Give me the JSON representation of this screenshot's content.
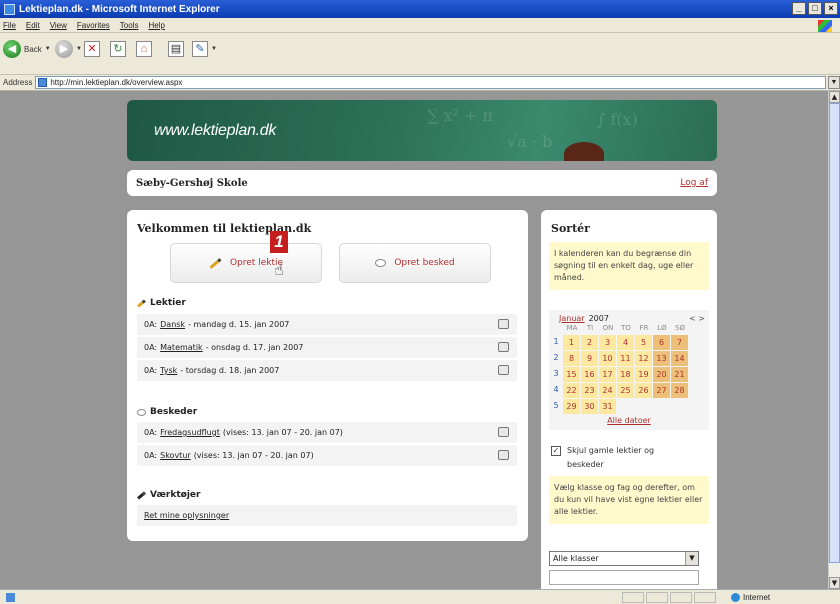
{
  "window": {
    "title": "Lektieplan.dk - Microsoft Internet Explorer",
    "btns": [
      "_",
      "□",
      "×"
    ]
  },
  "menu": [
    "File",
    "Edit",
    "View",
    "Favorites",
    "Tools",
    "Help"
  ],
  "toolbar": {
    "back": "Back"
  },
  "address": {
    "label": "Address",
    "url": "http://min.lektieplan.dk/overview.aspx"
  },
  "banner": {
    "url": "www.lektieplan.dk"
  },
  "school": {
    "name": "Sæby-Gershøj Skole",
    "logout": "Log af"
  },
  "main": {
    "title": "Velkommen til lektieplan.dk",
    "btn_create_homework": "Opret lektie",
    "btn_create_message": "Opret besked",
    "step_badge": "1",
    "homework_title": "Lektier",
    "homework": [
      {
        "prefix": "0A:",
        "subject": "Dansk",
        "suffix": "- mandag d. 15. jan 2007"
      },
      {
        "prefix": "0A:",
        "subject": "Matematik",
        "suffix": "- onsdag d. 17. jan 2007"
      },
      {
        "prefix": "0A:",
        "subject": "Tysk",
        "suffix": "- torsdag d. 18. jan 2007"
      }
    ],
    "messages_title": "Beskeder",
    "messages": [
      {
        "prefix": "0A:",
        "subject": "Fredagsudflugt",
        "suffix": "(vises: 13. jan 07 - 20. jan 07)"
      },
      {
        "prefix": "0A:",
        "subject": "Skovtur",
        "suffix": "(vises: 13. jan 07 - 20. jan 07)"
      }
    ],
    "tools_title": "Værktøjer",
    "tools_link": "Ret mine oplysninger"
  },
  "sidebar": {
    "title": "Sortér",
    "note1": "I kalenderen kan du begrænse din søgning til en enkelt dag, uge eller måned.",
    "calendar": {
      "month": "Januar",
      "year": "2007",
      "nav": "< >",
      "weekdays": [
        "MA",
        "TI",
        "ON",
        "TO",
        "FR",
        "LØ",
        "SØ"
      ],
      "weeks": [
        {
          "num": "1",
          "days": [
            "1",
            "2",
            "3",
            "4",
            "5",
            "6",
            "7"
          ]
        },
        {
          "num": "2",
          "days": [
            "8",
            "9",
            "10",
            "11",
            "12",
            "13",
            "14"
          ]
        },
        {
          "num": "3",
          "days": [
            "15",
            "16",
            "17",
            "18",
            "19",
            "20",
            "21"
          ]
        },
        {
          "num": "4",
          "days": [
            "22",
            "23",
            "24",
            "25",
            "26",
            "27",
            "28"
          ]
        },
        {
          "num": "5",
          "days": [
            "29",
            "30",
            "31"
          ]
        }
      ],
      "all_dates": "Alle datoer"
    },
    "hide_old": {
      "checked": true,
      "label": "Skjul gamle lektier og beskeder",
      "mark": "✓"
    },
    "note2": "Vælg klasse og fag og derefter, om du kun vil have vist egne lektier eller alle lektier.",
    "class_select": "Alle klasser"
  },
  "status": {
    "zone": "Internet"
  }
}
